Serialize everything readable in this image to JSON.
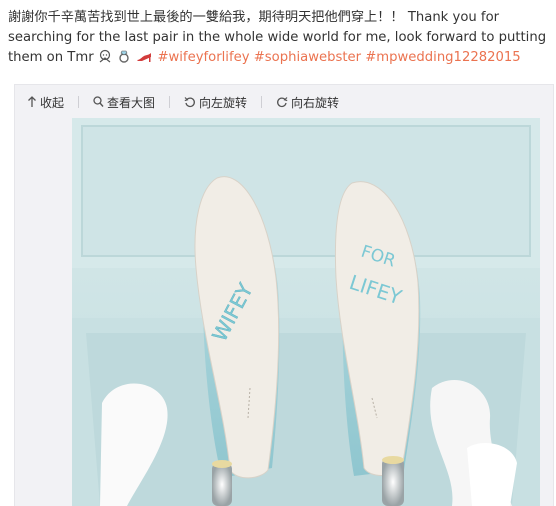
{
  "post": {
    "text_cn": "謝謝你千辛萬苦找到世上最後的一雙給我，期待明天把他們穿上！！",
    "text_en": "Thank you for searching for the last pair in the whole wide world for me, look forward to putting them on Tmr",
    "emojis": [
      "bride-icon",
      "ring-icon",
      "high-heel-icon"
    ],
    "hashtags": [
      "#wifeyforlifey",
      "#sophiawebster",
      "#mpwedding12282015"
    ]
  },
  "toolbar": {
    "collapse": "收起",
    "view_large": "查看大图",
    "rotate_left": "向左旋转",
    "rotate_right": "向右旋转"
  },
  "photo": {
    "left_sole_text": "WIFEY",
    "right_sole_text_line1": "FOR",
    "right_sole_text_line2": "LIFEY"
  },
  "colors": {
    "hashtag": "#eb7350",
    "text": "#333333",
    "box": "#cfe6e7",
    "sole": "#f1ede6"
  }
}
